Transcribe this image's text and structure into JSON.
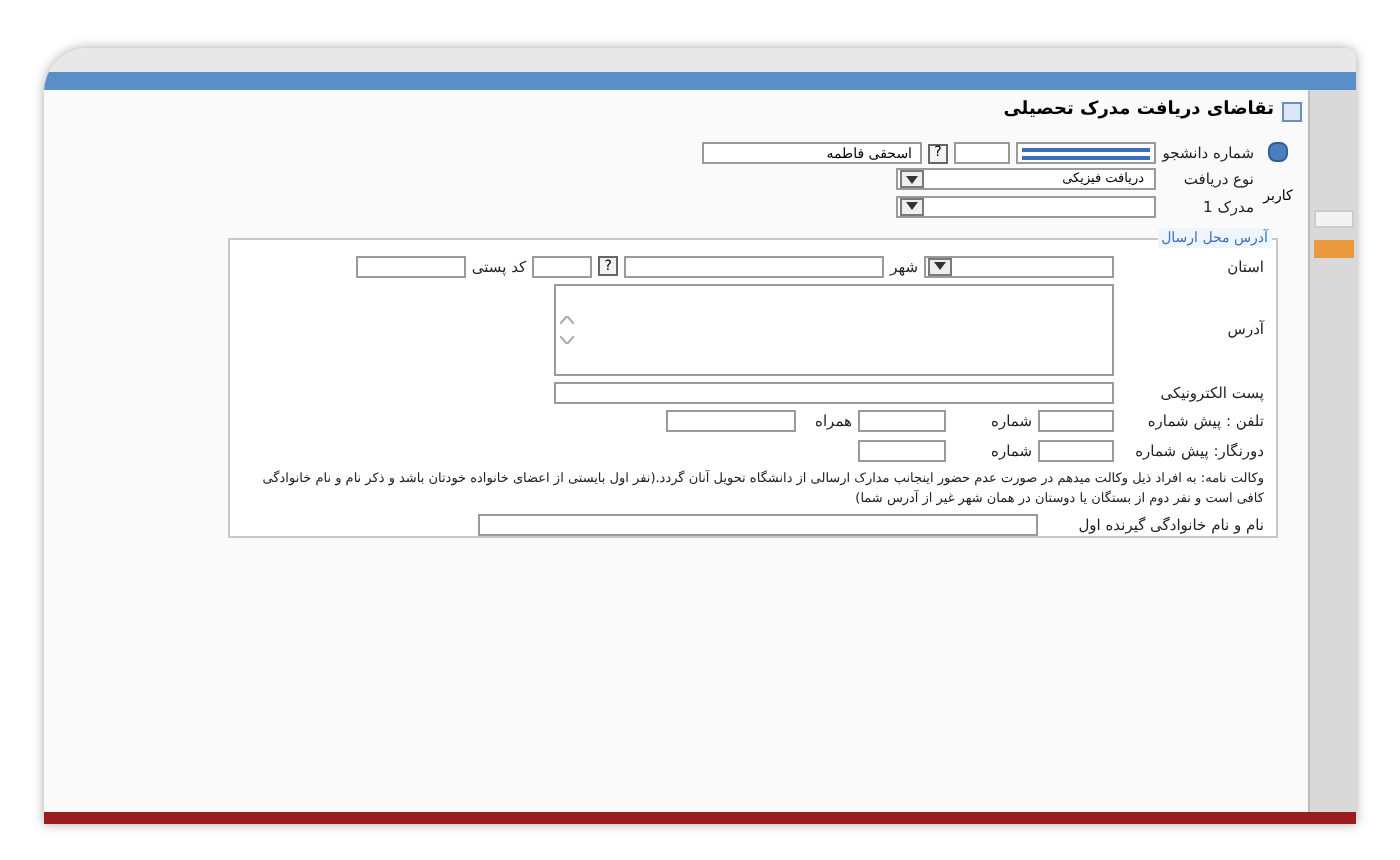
{
  "title": "تقاضای دریافت مدرک تحصیلی",
  "student": {
    "label": "شماره دانشجو",
    "name_value": "اسحقی فاطمه",
    "lookup": "?"
  },
  "receive_type": {
    "label": "نوع دریافت",
    "value": "دریافت فیزیکی"
  },
  "document": {
    "label": "مدرک 1"
  },
  "side_label": "کاربر",
  "address_section": {
    "legend": "آدرس محل ارسال",
    "province_label": "استان",
    "city_label": "شهر",
    "lookup": "?",
    "postal_label": "کد پستی",
    "address_label": "آدرس",
    "email_label": "پست الکترونیکی",
    "phone": {
      "label": "تلفن : پیش شماره",
      "number_label": "شماره",
      "mobile_label": "همراه"
    },
    "fax": {
      "label": "دورنگار: پیش شماره",
      "number_label": "شماره"
    },
    "proxy_note": "وکالت نامه: به افراد ذیل وکالت میدهم در صورت عدم حضور اینجانب مدارک ارسالی از دانشگاه تحویل آنان گردد.(نفر اول بایستی از اعضای خانواده خودتان باشد و ذکر نام و نام خانوادگی کافی است و نفر دوم از بستگان یا دوستان در همان شهر غیر از آدرس شما)",
    "recipient_label": "نام و نام خانوادگی گیرنده اول"
  }
}
